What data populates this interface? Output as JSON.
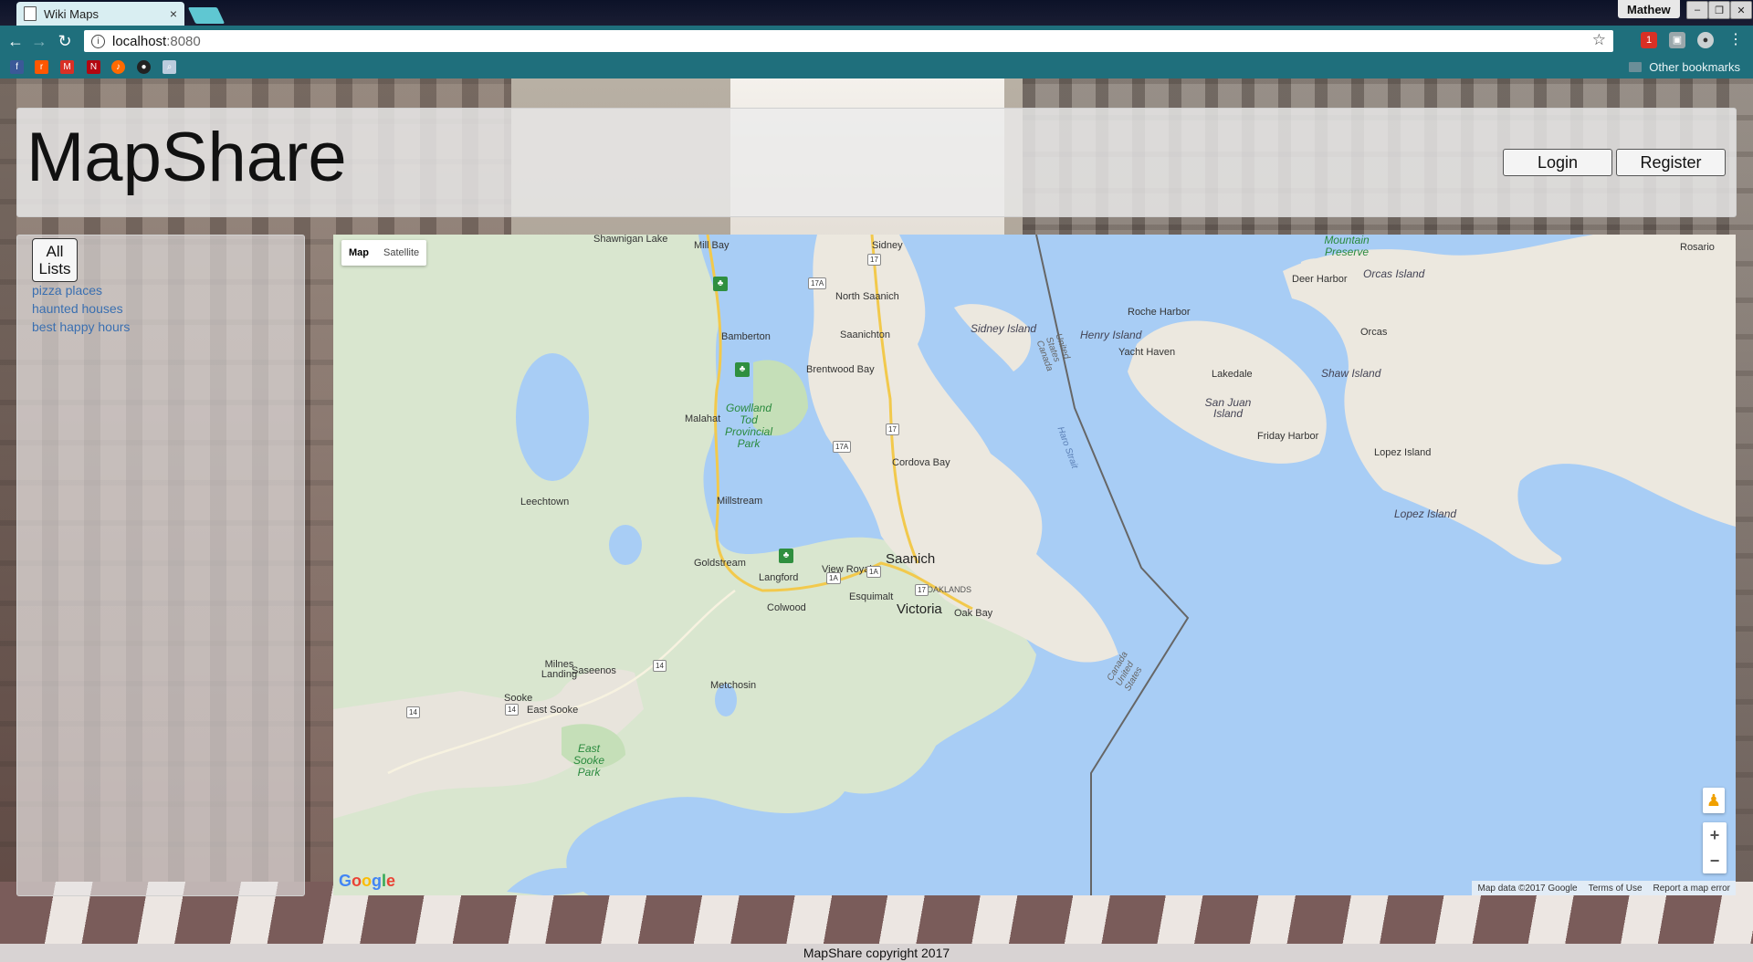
{
  "browser": {
    "tab_title": "Wiki Maps",
    "tab_close": "×",
    "user": "Mathew",
    "window_buttons": [
      "–",
      "❐",
      "✕"
    ],
    "url_host": "localhost",
    "url_port": ":8080",
    "other_bookmarks": "Other bookmarks",
    "gmail_badge": "1"
  },
  "header": {
    "brand": "MapShare",
    "login_label": "Login",
    "register_label": "Register"
  },
  "sidebar": {
    "all_lists_label": "All Lists",
    "lists": [
      "pizza places",
      "haunted houses",
      "best happy hours"
    ]
  },
  "map": {
    "type_buttons": [
      "Map",
      "Satellite"
    ],
    "active_type": "Map",
    "zoom_in": "+",
    "zoom_out": "−",
    "google_logo": "Google",
    "attribution": [
      "Map data ©2017 Google",
      "Terms of Use",
      "Report a map error"
    ],
    "places": {
      "shawnigan": "Shawnigan Lake",
      "millbay": "Mill Bay",
      "sidney": "Sidney",
      "northsaanich": "North Saanich",
      "bamberton": "Bamberton",
      "saanichton": "Saanichton",
      "brentwood": "Brentwood Bay",
      "malahat": "Malahat",
      "gowlland": "Gowlland Tod Provincial Park",
      "sidneyisland": "Sidney Island",
      "leechtown": "Leechtown",
      "millstream": "Millstream",
      "cordova": "Cordova Bay",
      "goldstream": "Goldstream",
      "viewroyal": "View Royal",
      "saanich": "Saanich",
      "langford": "Langford",
      "esquimalt": "Esquimalt",
      "oaklands": "OAKLANDS",
      "victoria": "Victoria",
      "oakbay": "Oak Bay",
      "colwood": "Colwood",
      "milnes": "Milnes Landing",
      "saseenos": "Saseenos",
      "metchosin": "Metchosin",
      "sooke": "Sooke",
      "eastsooke": "East Sooke",
      "eastsookepark": "East Sooke Park",
      "mountainpreserve": "Mountain Preserve",
      "rosario": "Rosario",
      "deerharbor": "Deer Harbor",
      "orcasisland": "Orcas Island",
      "rocheharbor": "Roche Harbor",
      "henryisland": "Henry Island",
      "yachthaven": "Yacht Haven",
      "orcas": "Orcas",
      "lakedale": "Lakedale",
      "shawisland": "Shaw Island",
      "sanjuanisland": "San Juan Island",
      "fridayharbor": "Friday Harbor",
      "lopezisland1": "Lopez Island",
      "lopezisland2": "Lopez Island",
      "harostrait": "Haro Strait",
      "border1": "United States Canada",
      "border2": "Canada United States"
    },
    "shields": [
      "17",
      "17A",
      "17",
      "17A",
      "1A",
      "1A",
      "17",
      "14",
      "14",
      "14"
    ]
  },
  "footer": {
    "copyright": "MapShare copyright 2017"
  }
}
